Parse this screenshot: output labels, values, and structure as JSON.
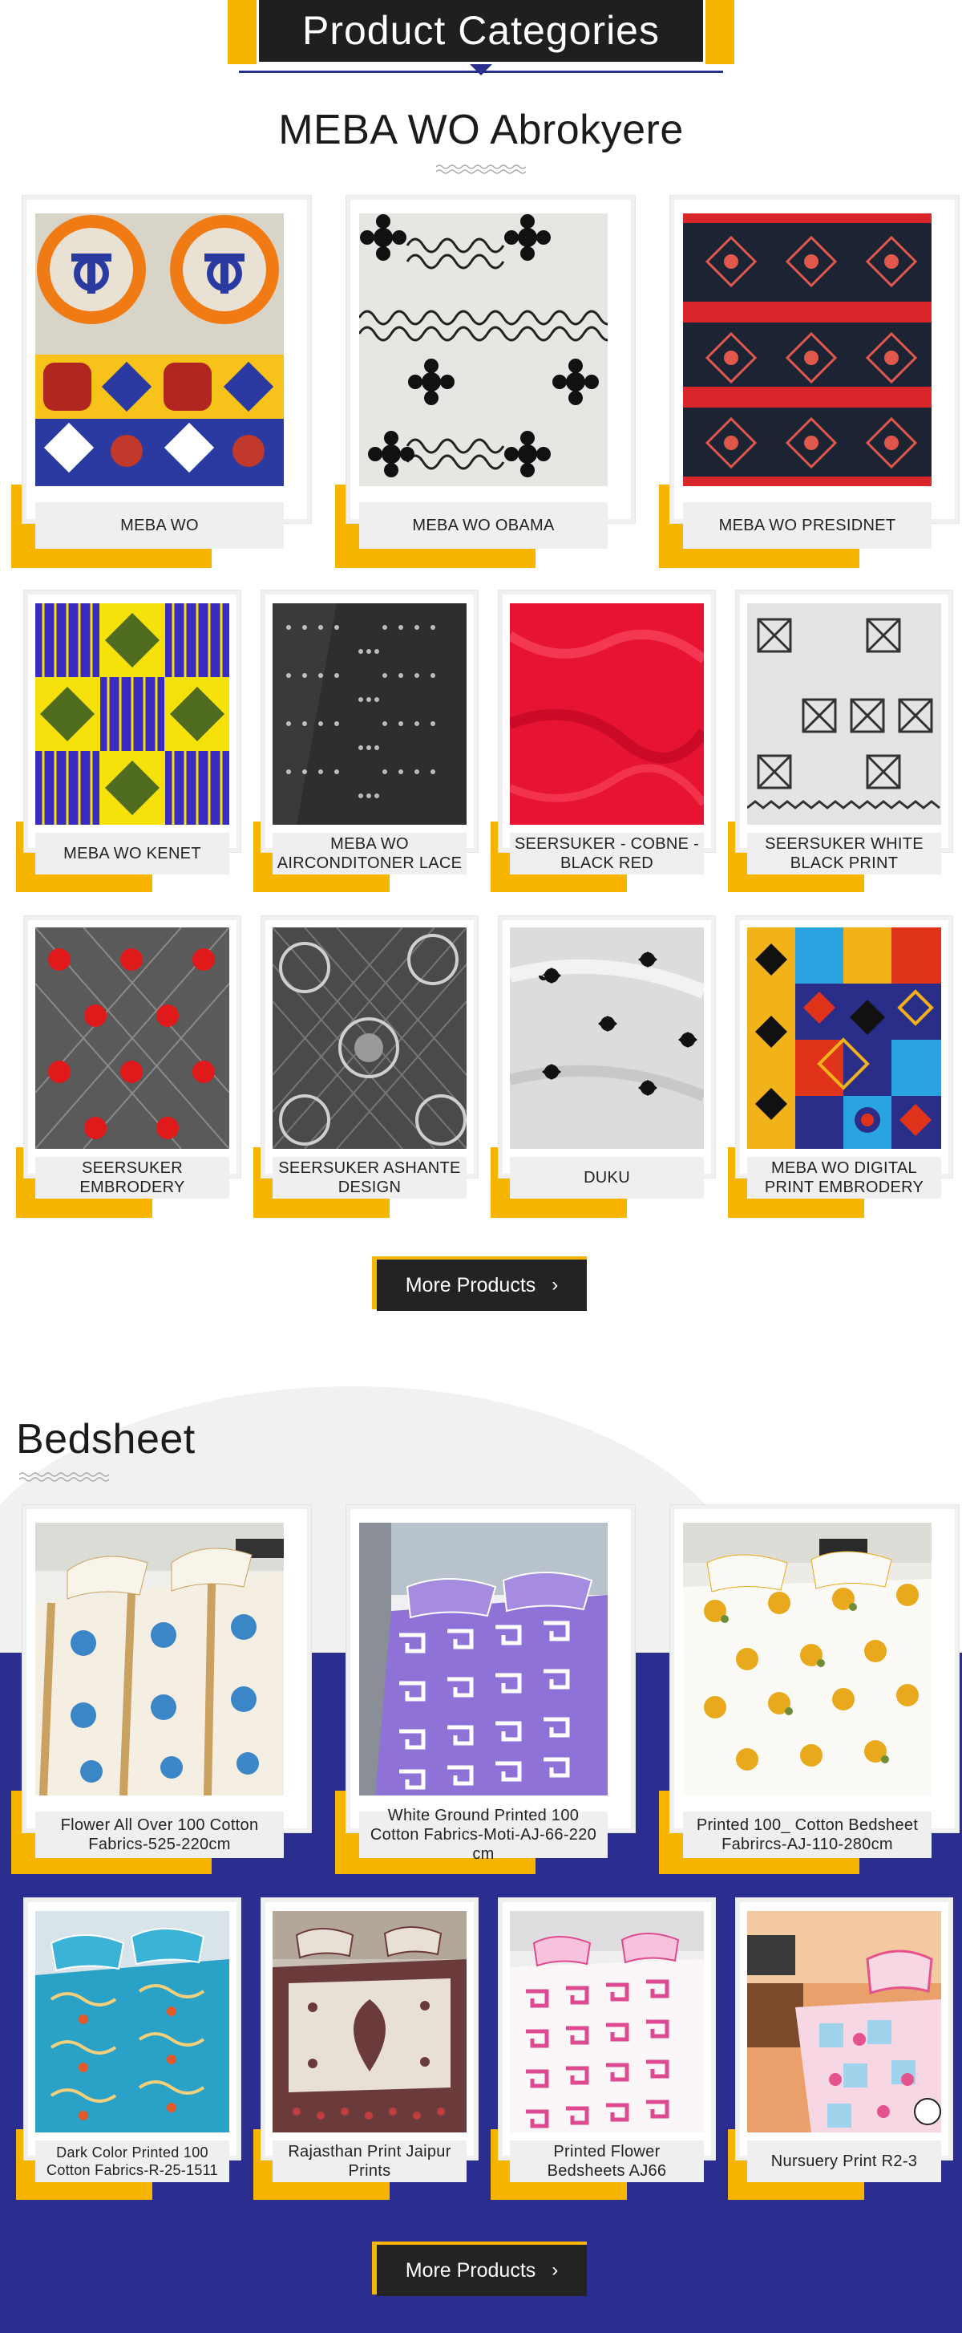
{
  "header": {
    "title": "Product Categories"
  },
  "meba": {
    "title": "MEBA WO Abrokyere",
    "items": [
      {
        "label": "MEBA WO"
      },
      {
        "label": "MEBA WO OBAMA"
      },
      {
        "label": "MEBA WO PRESIDNET"
      },
      {
        "label": "MEBA WO KENET"
      },
      {
        "label": "MEBA WO AIRCONDITONER LACE"
      },
      {
        "label": "SEERSUKER - COBNE - BLACK RED"
      },
      {
        "label": "SEERSUKER WHITE BLACK PRINT"
      },
      {
        "label": "SEERSUKER EMBRODERY"
      },
      {
        "label": "SEERSUKER ASHANTE DESIGN"
      },
      {
        "label": "DUKU"
      },
      {
        "label": "MEBA WO DIGITAL PRINT EMBRODERY"
      }
    ],
    "more_label": "More Products"
  },
  "bedsheet": {
    "title": "Bedsheet",
    "items": [
      {
        "label": "Flower All Over 100 Cotton Fabrics-525-220cm"
      },
      {
        "label": "White Ground Printed 100 Cotton Fabrics-Moti-AJ-66-220 cm"
      },
      {
        "label": "Printed 100_ Cotton Bedsheet Fabrircs-AJ-110-280cm"
      },
      {
        "label": "Dark Color Printed 100 Cotton Fabrics-R-25-1511"
      },
      {
        "label": "Rajasthan Print Jaipur Prints"
      },
      {
        "label": "Printed Flower Bedsheets AJ66"
      },
      {
        "label": "Nursuery Print R2-3"
      }
    ],
    "more_label": "More Products"
  },
  "colors": {
    "accent": "#f7b500",
    "dark": "#1f1f1f",
    "navy": "#2b2e8f"
  }
}
